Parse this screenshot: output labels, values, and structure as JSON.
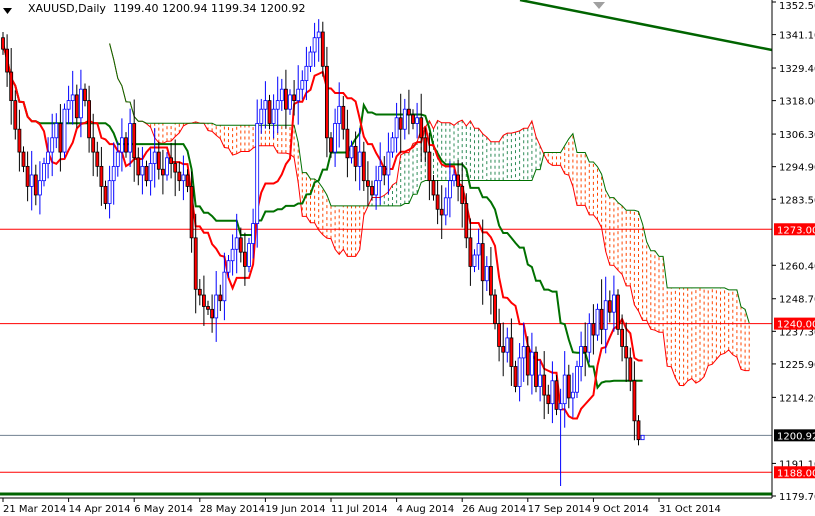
{
  "header": {
    "symbol": "XAUUSD,Daily",
    "open": "1199.40",
    "high": "1200.94",
    "low": "1199.34",
    "close": "1200.92"
  },
  "chart_data": {
    "type": "candlestick",
    "title": "XAUUSD,Daily",
    "indicators": [
      "Ichimoku Kinko Hyo (9,26,52)"
    ],
    "ylim": [
      1179.7,
      1352.5
    ],
    "y_ticks": [
      "1352.50",
      "1341.10",
      "1329.40",
      "1318.00",
      "1306.30",
      "1294.90",
      "1283.50",
      "1260.40",
      "1248.70",
      "1237.30",
      "1225.90",
      "1214.20",
      "1191.10",
      "1179.70"
    ],
    "x_ticks": [
      "21 Mar 2014",
      "14 Apr 2014",
      "6 May 2014",
      "28 May 2014",
      "19 Jun 2014",
      "11 Jul 2014",
      "4 Aug 2014",
      "26 Aug 2014",
      "17 Sep 2014",
      "9 Oct 2014",
      "31 Oct 2014"
    ],
    "bars_per_x_tick": 16,
    "first_open": 1340,
    "closes": [
      1336,
      1328,
      1318,
      1308,
      1300,
      1295,
      1288,
      1292,
      1285,
      1290,
      1296,
      1300,
      1305,
      1310,
      1300,
      1315,
      1318,
      1320,
      1312,
      1322,
      1318,
      1305,
      1300,
      1295,
      1288,
      1282,
      1290,
      1295,
      1300,
      1305,
      1300,
      1310,
      1298,
      1292,
      1295,
      1290,
      1296,
      1300,
      1294,
      1292,
      1298,
      1296,
      1293,
      1290,
      1292,
      1288,
      1270,
      1252,
      1250,
      1246,
      1245,
      1242,
      1250,
      1248,
      1258,
      1262,
      1266,
      1270,
      1265,
      1260,
      1268,
      1275,
      1310,
      1315,
      1318,
      1310,
      1315,
      1318,
      1322,
      1315,
      1320,
      1318,
      1322,
      1325,
      1330,
      1335,
      1340,
      1342,
      1330,
      1305,
      1300,
      1310,
      1316,
      1308,
      1298,
      1302,
      1295,
      1300,
      1290,
      1288,
      1285,
      1290,
      1295,
      1292,
      1300,
      1305,
      1312,
      1308,
      1315,
      1313,
      1310,
      1312,
      1305,
      1300,
      1290,
      1285,
      1280,
      1278,
      1284,
      1290,
      1292,
      1288,
      1282,
      1270,
      1260,
      1264,
      1268,
      1255,
      1260,
      1250,
      1240,
      1232,
      1230,
      1235,
      1225,
      1218,
      1228,
      1232,
      1222,
      1230,
      1218,
      1222,
      1215,
      1212,
      1220,
      1210,
      1212,
      1222,
      1214,
      1216,
      1225,
      1232,
      1230,
      1240,
      1236,
      1245,
      1238,
      1248,
      1244,
      1250,
      1238,
      1232,
      1228,
      1220,
      1206,
      1199.4,
      1200.92
    ],
    "last_bar": {
      "open": 1199.4,
      "high": 1200.94,
      "low": 1199.34,
      "close": 1200.92
    },
    "extremes": [
      {
        "bar": 136,
        "low": 1183.2
      },
      {
        "bar": 77,
        "high": 1346.5
      },
      {
        "bar": 146,
        "high": 1255.5
      }
    ],
    "horizontal_levels": [
      {
        "label": "1273.00",
        "value": 1273.0,
        "color": "#ff0000"
      },
      {
        "label": "1240.00",
        "value": 1240.0,
        "color": "#ff0000"
      },
      {
        "label": "1188.00",
        "value": 1188.0,
        "color": "#ff0000"
      }
    ],
    "bid_line": {
      "label": "1200.92",
      "value": 1200.92,
      "color": "#708090"
    },
    "colors": {
      "bull": "#0000ff",
      "bear": "#ff0000",
      "tenkan": "#ff0000",
      "kijun": "#007000",
      "cloud_up": "#2e8b57",
      "cloud_down": "#ff4500",
      "trendline": "#006400"
    }
  }
}
